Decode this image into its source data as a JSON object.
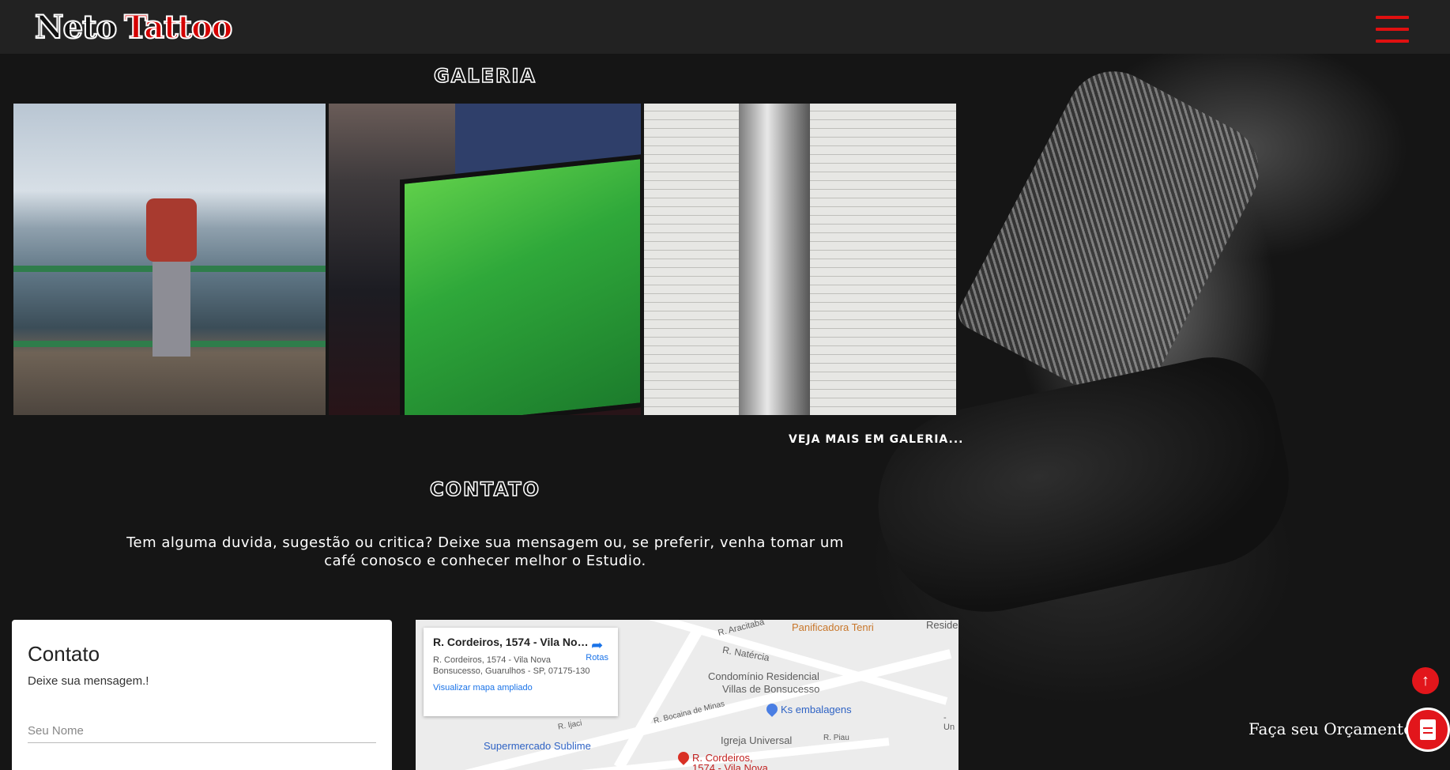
{
  "header": {
    "logo_word_1": "Neto",
    "logo_word_2": "Tattoo",
    "menu_icon": "hamburger-icon",
    "accent_color": "#e01010"
  },
  "gallery": {
    "title": "GALERIA",
    "see_more": "VEJA MAIS EM GALERIA...",
    "images": [
      "Person at railing overlooking city and sea",
      "Zelda Link's Awakening game display",
      "Flute on sheet music"
    ]
  },
  "contact_section": {
    "title": "CONTATO",
    "intro": "Tem alguma duvida, sugestão ou critica? Deixe sua mensagem ou, se preferir, venha tomar um café conosco e conhecer melhor o Estudio."
  },
  "contact_card": {
    "heading": "Contato",
    "subtitle": "Deixe sua mensagem.!",
    "name_placeholder": "Seu Nome"
  },
  "map": {
    "card_title": "R. Cordeiros, 1574 - Vila Nova ...",
    "card_address": "R. Cordeiros, 1574 - Vila Nova Bonsucesso, Guarulhos - SP, 07175-130",
    "card_link": "Visualizar mapa ampliado",
    "directions_label": "Rotas",
    "labels": {
      "panificadora": "Panificadora Tenri",
      "reside": "Reside",
      "aracitaba": "R. Aracitaba",
      "natercia": "R. Natércia",
      "condominio_1": "Condomínio Residencial",
      "condominio_2": "Villas de Bonsucesso",
      "ks": "Ks embalagens",
      "bocaina": "R. Bocaina de Minas",
      "ijaci": "R. Ijaci",
      "igreja": "Igreja Universal",
      "piau": "R. Piau",
      "supermercado": "Supermercado Sublime",
      "un": "- Un",
      "pin_label_1": "R. Cordeiros,",
      "pin_label_2": "1574 - Vila Nova"
    }
  },
  "floating": {
    "quote_label": "Faça seu Orçamento",
    "top_icon": "arrow-up-icon",
    "quote_icon": "document-icon",
    "button_color": "#e2161b"
  }
}
